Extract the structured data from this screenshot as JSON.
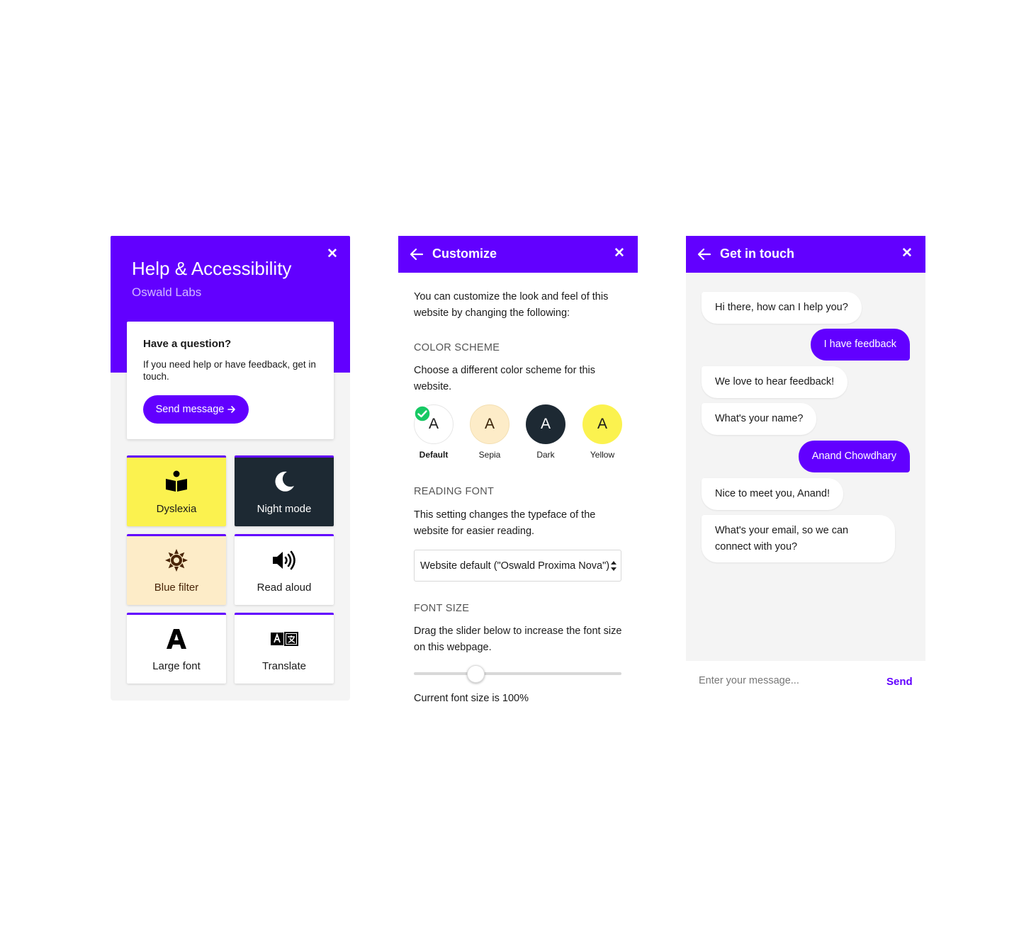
{
  "help_panel": {
    "title": "Help & Accessibility",
    "subtitle": "Oswald Labs",
    "close_icon": "close-icon",
    "question": {
      "title": "Have a question?",
      "body": "If you need help or have feedback, get in touch.",
      "button_label": "Send message",
      "button_icon": "arrow-right-icon"
    },
    "tiles": [
      {
        "label": "Dyslexia",
        "icon": "reading-person-icon"
      },
      {
        "label": "Night mode",
        "icon": "moon-icon"
      },
      {
        "label": "Blue filter",
        "icon": "sun-icon"
      },
      {
        "label": "Read aloud",
        "icon": "speaker-icon"
      },
      {
        "label": "Large font",
        "icon": "letter-a-icon"
      },
      {
        "label": "Translate",
        "icon": "translate-icon"
      }
    ]
  },
  "customize_panel": {
    "title": "Customize",
    "intro": "You can customize the look and feel of this website by changing the following:",
    "color_scheme": {
      "heading": "COLOR SCHEME",
      "description": "Choose a different color scheme for this website.",
      "selected": "Default",
      "options": [
        {
          "letter": "A",
          "label": "Default",
          "color": "#ffffff"
        },
        {
          "letter": "A",
          "label": "Sepia",
          "color": "#fdecc8"
        },
        {
          "letter": "A",
          "label": "Dark",
          "color": "#1d2933"
        },
        {
          "letter": "A",
          "label": "Yellow",
          "color": "#fbf24f"
        }
      ]
    },
    "reading_font": {
      "heading": "READING FONT",
      "description": "This setting changes the typeface of the website for easier reading.",
      "selected_value": "Website default (\"Oswald Proxima Nova\")"
    },
    "font_size": {
      "heading": "FONT SIZE",
      "description": "Drag the slider below to increase the font size on this webpage.",
      "slider_percent": 100,
      "readout": "Current font size is 100%"
    }
  },
  "chat_panel": {
    "title": "Get in touch",
    "messages": [
      {
        "from": "bot",
        "text": "Hi there, how can I help you?"
      },
      {
        "from": "user",
        "text": "I have feedback"
      },
      {
        "from": "bot",
        "text": "We love to hear feedback!"
      },
      {
        "from": "bot",
        "text": "What's your name?"
      },
      {
        "from": "user",
        "text": "Anand Chowdhary"
      },
      {
        "from": "bot",
        "text": "Nice to meet you, Anand!"
      },
      {
        "from": "bot",
        "text": "What's your email, so we can connect with you?"
      }
    ],
    "input_placeholder": "Enter your message...",
    "send_label": "Send"
  },
  "colors": {
    "brand": "#6200ff",
    "panel_background": "#f4f4f4",
    "dark_tile": "#1d2933",
    "yellow_tile": "#fbf24f",
    "sepia_tile": "#fdecc8",
    "check_green": "#17c964"
  }
}
